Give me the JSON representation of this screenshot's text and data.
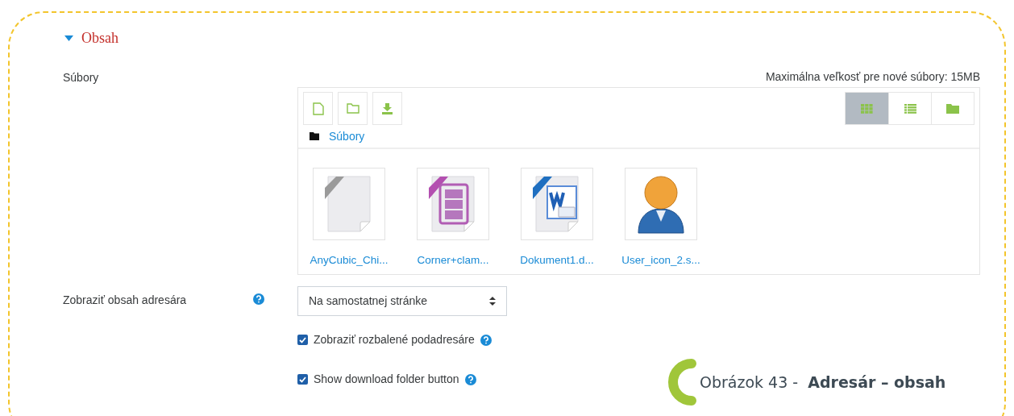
{
  "section": {
    "title": "Obsah",
    "expanded": true
  },
  "files_field": {
    "label": "Súbory",
    "max_size": "Maximálna veľkosť pre nové súbory: 15MB",
    "toolbar": [
      {
        "kind": "file"
      },
      {
        "kind": "folder"
      },
      {
        "kind": "download"
      }
    ],
    "views": [
      {
        "kind": "grid",
        "selected": true
      },
      {
        "kind": "list",
        "selected": false
      },
      {
        "kind": "tree",
        "selected": false
      }
    ],
    "path": "Súbory",
    "files": [
      {
        "name": "AnyCubic_Chi...",
        "kind": "generic"
      },
      {
        "name": "Corner+clam...",
        "kind": "archive"
      },
      {
        "name": "Dokument1.d...",
        "kind": "word"
      },
      {
        "name": "User_icon_2.s...",
        "kind": "image"
      }
    ]
  },
  "display": {
    "label": "Zobraziť obsah adresára",
    "value": "Na samostatnej stránke"
  },
  "options": [
    {
      "label": "Zobraziť rozbalené podadresáre",
      "checked": true
    },
    {
      "label": "Show download folder button",
      "checked": true
    }
  ],
  "caption": "Obrázok 43 -  **Adresár – obsah**"
}
